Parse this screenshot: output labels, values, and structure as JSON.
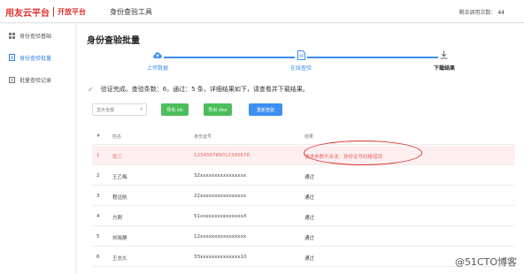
{
  "header": {
    "brand": "用友云平台",
    "open_platform": "开放平台",
    "tool_title": "身份查验工具",
    "remaining_label": "剩余调用次数：",
    "remaining_count": "44"
  },
  "sidebar": {
    "items": [
      {
        "label": "身份查验基础",
        "icon": "grid-icon",
        "active": false
      },
      {
        "label": "身份查验批量",
        "icon": "document-icon",
        "active": true
      },
      {
        "label": "批量查验记录",
        "icon": "list-icon",
        "active": false
      }
    ]
  },
  "main": {
    "title": "身份查验批量",
    "steps": [
      {
        "label": "上传数据",
        "icon": "cloud-upload-icon",
        "state": "done"
      },
      {
        "label": "在线查验",
        "icon": "file-icon",
        "state": "done"
      },
      {
        "label": "下载结果",
        "icon": "download-icon",
        "state": "current"
      }
    ],
    "notice": "验证完成。查验条数：6，通过：5 条，详细结果如下，请查看并下载结果。",
    "controls": {
      "filter_value": "显示全部",
      "export_xls": "导出 xls",
      "export_xlsx": "导出 xlsx",
      "recheck": "重新查验"
    },
    "table": {
      "headers": [
        "#",
        "姓名",
        "身份证号",
        "结果"
      ],
      "rows": [
        {
          "index": "1",
          "name": "张三",
          "id_number": "123456789012345678",
          "result": "请求参数不合法：身份证号码格错误",
          "status": "error"
        },
        {
          "index": "2",
          "name": "王乙梅",
          "id_number": "32xxxxxxxxxxxxxxxx",
          "result": "通过",
          "status": "ok"
        },
        {
          "index": "3",
          "name": "程远航",
          "id_number": "22xxxxxxxxxxxxxxxx",
          "result": "通过",
          "status": "ok"
        },
        {
          "index": "4",
          "name": "方刚",
          "id_number": "51xxxxxxxxxxxxxxxX",
          "result": "通过",
          "status": "ok"
        },
        {
          "index": "5",
          "name": "刘晓静",
          "id_number": "12xxxxxxxxxxxxxxxx",
          "result": "通过",
          "status": "ok"
        },
        {
          "index": "6",
          "name": "王志久",
          "id_number": "33xxxxxxxxxxxxxx10",
          "result": "通过",
          "status": "ok"
        }
      ]
    }
  },
  "watermark": "@51CTO博客",
  "colors": {
    "brand_red": "#e0312f",
    "accent_blue": "#2f7ce5",
    "button_green": "#4cbe5b",
    "button_blue": "#3d8ff0",
    "error_text": "#e66464",
    "annotation_red": "#d8302b"
  }
}
